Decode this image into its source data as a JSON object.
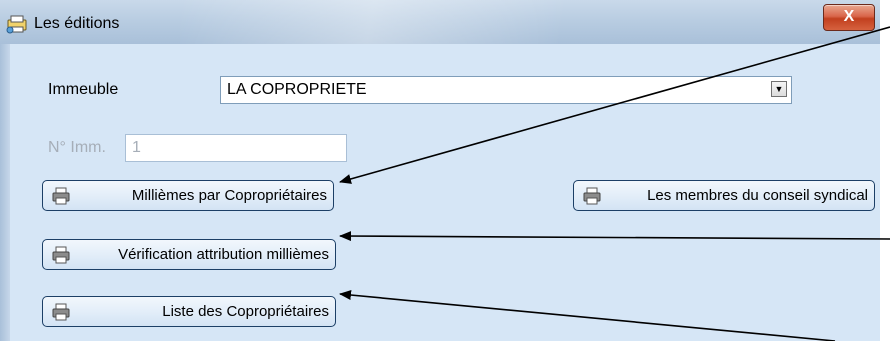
{
  "window": {
    "title": "Les éditions",
    "close_label": "X"
  },
  "form": {
    "immeuble_label": "Immeuble",
    "immeuble_value": "LA COPROPRIETE",
    "num_label": "N° Imm.",
    "num_value": "1"
  },
  "buttons": {
    "milliemes": "Millièmes par Copropriétaires",
    "conseil": "Les membres du conseil syndical",
    "verification": "Vérification attribution millièmes",
    "liste": "Liste des Copropriétaires"
  },
  "icons": {
    "app": "app-icon",
    "printer": "printer-icon",
    "dropdown": "chevron-down-icon"
  }
}
